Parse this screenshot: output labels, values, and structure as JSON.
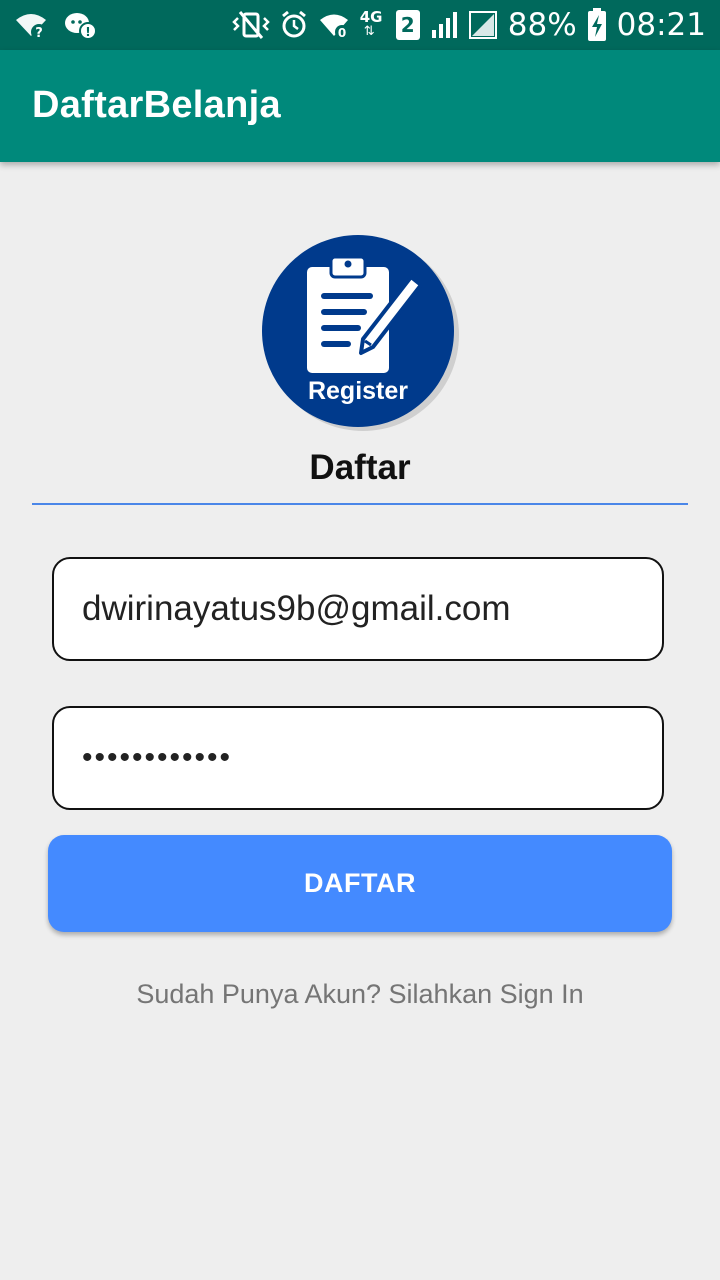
{
  "status_bar": {
    "battery_percent": "88%",
    "time": "08:21",
    "network_label": "4G",
    "sim_label": "2",
    "icons_left": [
      "wifi-question-icon",
      "wechat-badge-icon"
    ],
    "icons_right": [
      "vibrate-mute-icon",
      "alarm-icon",
      "wifi-icon",
      "network-4g-icon",
      "sim2-icon",
      "signal-icon",
      "signal-icon",
      "battery-charging-icon"
    ]
  },
  "app_bar": {
    "title": "DaftarBelanja"
  },
  "logo": {
    "label": "Register",
    "icon": "clipboard-pen-icon",
    "circle_color": "#003a8c"
  },
  "form": {
    "heading": "Daftar",
    "email_value": "dwirinayatus9b@gmail.com",
    "password_value": "••••••••••••",
    "submit_label": "DAFTAR",
    "signin_link": "Sudah Punya Akun? Silahkan Sign In"
  },
  "colors": {
    "status_bar": "#00695c",
    "app_bar": "#00897b",
    "button": "#448aff",
    "divider": "#4a86e8",
    "background": "#eeeeee"
  }
}
